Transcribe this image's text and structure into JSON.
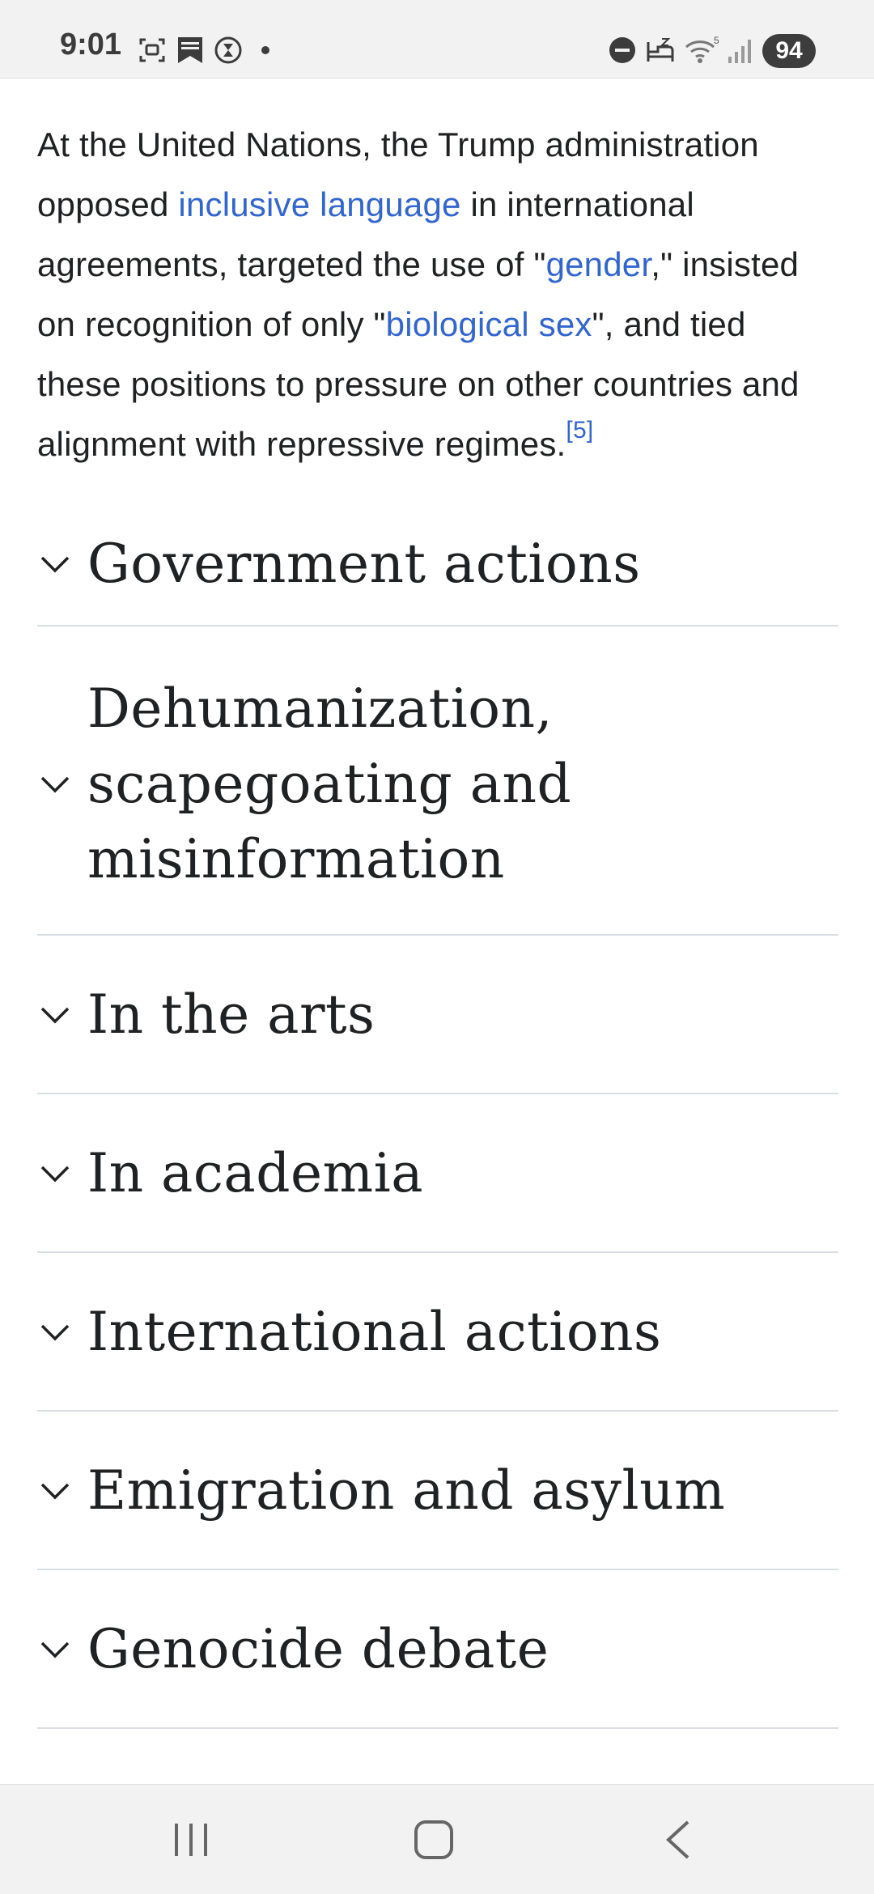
{
  "status_bar": {
    "time": "9:01",
    "battery": "94",
    "icons": [
      "screenshot-icon",
      "bookmark-icon",
      "timer-icon",
      "dot-icon",
      "dnd-icon",
      "sleep-icon",
      "wifi-icon",
      "signal-icon"
    ]
  },
  "article": {
    "intro": {
      "part1": "At the United Nations, the Trump administration opposed ",
      "link1": "inclusive language",
      "part2": " in international agreements, targeted the use of \"",
      "link2": "gender",
      "part3": ",\" insisted on recognition of only \"",
      "link3": "biological sex",
      "part4": "\", and tied these positions to pressure on other countries and alignment with repressive regimes.",
      "ref": "[5]"
    },
    "sections": [
      {
        "title": "Government actions"
      },
      {
        "title": "Dehumanization, scapegoating and misinformation"
      },
      {
        "title": "In the arts"
      },
      {
        "title": "In academia"
      },
      {
        "title": "International actions"
      },
      {
        "title": "Emigration and asylum"
      },
      {
        "title": "Genocide debate"
      }
    ]
  },
  "nav_bar": {
    "buttons": [
      "recent-apps-icon",
      "home-icon",
      "back-icon"
    ]
  }
}
